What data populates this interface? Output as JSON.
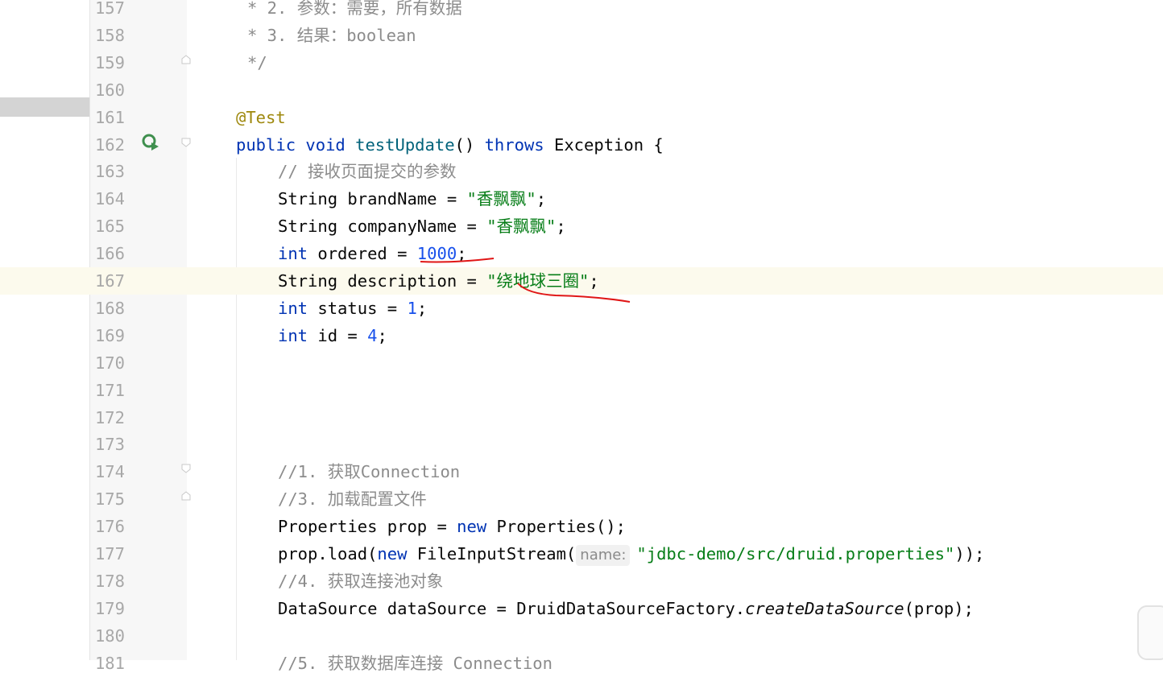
{
  "editor": {
    "lines": [
      {
        "num": "157",
        "parts": [
          {
            "t": "* 2. 参数：需要，所有数据",
            "c": "cm"
          }
        ],
        "indent": 14
      },
      {
        "num": "158",
        "parts": [
          {
            "t": "* 3. 结果：boolean",
            "c": "cm"
          }
        ],
        "indent": 14
      },
      {
        "num": "159",
        "parts": [
          {
            "t": "*/",
            "c": "cm"
          }
        ],
        "indent": 14
      },
      {
        "num": "160",
        "parts": [],
        "indent": 0
      },
      {
        "num": "161",
        "parts": [
          {
            "t": "@Test",
            "c": "an"
          }
        ],
        "indent": 0
      },
      {
        "num": "162",
        "parts": [
          {
            "t": "public ",
            "c": "kw"
          },
          {
            "t": "void ",
            "c": "kw"
          },
          {
            "t": "testUpdate",
            "c": "fn"
          },
          {
            "t": "() ",
            "c": ""
          },
          {
            "t": "throws ",
            "c": "kw"
          },
          {
            "t": "Exception {",
            "c": ""
          }
        ],
        "indent": 0
      },
      {
        "num": "163",
        "parts": [
          {
            "t": "// 接收页面提交的参数",
            "c": "cm"
          }
        ],
        "indent": 52
      },
      {
        "num": "164",
        "parts": [
          {
            "t": "String brandName = ",
            "c": ""
          },
          {
            "t": "\"香飘飘\"",
            "c": "st"
          },
          {
            "t": ";",
            "c": ""
          }
        ],
        "indent": 52
      },
      {
        "num": "165",
        "parts": [
          {
            "t": "String companyName = ",
            "c": ""
          },
          {
            "t": "\"香飘飘\"",
            "c": "st"
          },
          {
            "t": ";",
            "c": ""
          }
        ],
        "indent": 52
      },
      {
        "num": "166",
        "parts": [
          {
            "t": "int ",
            "c": "kw"
          },
          {
            "t": "ordered = ",
            "c": ""
          },
          {
            "t": "1000",
            "c": "nm"
          },
          {
            "t": ";",
            "c": ""
          }
        ],
        "indent": 52
      },
      {
        "num": "167",
        "parts": [
          {
            "t": "String description = ",
            "c": ""
          },
          {
            "t": "\"绕地球三圈\"",
            "c": "st"
          },
          {
            "t": ";",
            "c": ""
          }
        ],
        "indent": 52,
        "current": true
      },
      {
        "num": "168",
        "parts": [
          {
            "t": "int ",
            "c": "kw"
          },
          {
            "t": "status = ",
            "c": ""
          },
          {
            "t": "1",
            "c": "nm"
          },
          {
            "t": ";",
            "c": ""
          }
        ],
        "indent": 52
      },
      {
        "num": "169",
        "parts": [
          {
            "t": "int ",
            "c": "kw"
          },
          {
            "t": "id = ",
            "c": ""
          },
          {
            "t": "4",
            "c": "nm"
          },
          {
            "t": ";",
            "c": ""
          }
        ],
        "indent": 52
      },
      {
        "num": "170",
        "parts": [],
        "indent": 0
      },
      {
        "num": "171",
        "parts": [],
        "indent": 0
      },
      {
        "num": "172",
        "parts": [],
        "indent": 0
      },
      {
        "num": "173",
        "parts": [],
        "indent": 0
      },
      {
        "num": "174",
        "parts": [
          {
            "t": "//1. 获取Connection",
            "c": "cm"
          }
        ],
        "indent": 52
      },
      {
        "num": "175",
        "parts": [
          {
            "t": "//3. 加载配置文件",
            "c": "cm"
          }
        ],
        "indent": 52
      },
      {
        "num": "176",
        "parts": [
          {
            "t": "Properties prop = ",
            "c": ""
          },
          {
            "t": "new ",
            "c": "kw"
          },
          {
            "t": "Properties();",
            "c": ""
          }
        ],
        "indent": 52
      },
      {
        "num": "177",
        "parts": [
          {
            "t": "prop.load(",
            "c": ""
          },
          {
            "t": "new ",
            "c": "kw"
          },
          {
            "t": "FileInputStream(",
            "c": ""
          },
          {
            "t": "name:",
            "c": "hint"
          },
          {
            "t": "\"jdbc-demo/src/druid.properties\"",
            "c": "st"
          },
          {
            "t": "));",
            "c": ""
          }
        ],
        "indent": 52
      },
      {
        "num": "178",
        "parts": [
          {
            "t": "//4. 获取连接池对象",
            "c": "cm"
          }
        ],
        "indent": 52
      },
      {
        "num": "179",
        "parts": [
          {
            "t": "DataSource dataSource = DruidDataSourceFactory.",
            "c": ""
          },
          {
            "t": "createDataSource",
            "c": "it"
          },
          {
            "t": "(prop);",
            "c": ""
          }
        ],
        "indent": 52
      },
      {
        "num": "180",
        "parts": [],
        "indent": 0
      },
      {
        "num": "181",
        "parts": [
          {
            "t": "//5. 获取数据库连接 Connection",
            "c": "cm"
          }
        ],
        "indent": 52
      }
    ]
  }
}
